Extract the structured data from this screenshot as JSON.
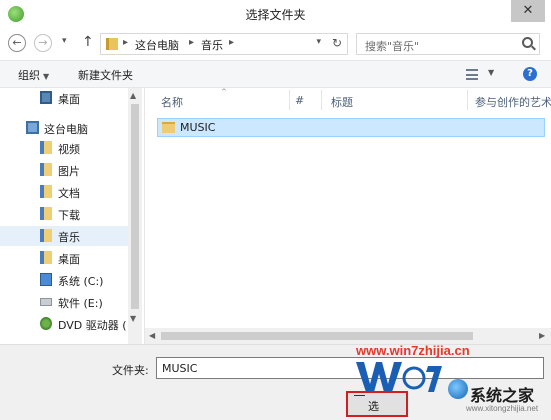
{
  "window": {
    "title": "选择文件夹",
    "close_glyph": "✕"
  },
  "nav": {
    "back_glyph": "←",
    "forward_glyph": "→",
    "history_glyph": "▾",
    "up_glyph": "↑",
    "breadcrumb": [
      "这台电脑",
      "音乐"
    ],
    "crumb_sep": "▸",
    "dropdown_glyph": "▾",
    "refresh_glyph": "↻"
  },
  "search": {
    "placeholder": "搜索\"音乐\""
  },
  "toolbar": {
    "organize_label": "组织",
    "organize_caret": "▼",
    "new_folder_label": "新建文件夹",
    "view_caret": "▼",
    "help_glyph": "?"
  },
  "sidebar": {
    "items": [
      {
        "label": "桌面",
        "icon": "desktop-icon"
      },
      {
        "label": "这台电脑",
        "icon": "computer-icon"
      },
      {
        "label": "视频",
        "icon": "video-folder-icon"
      },
      {
        "label": "图片",
        "icon": "pictures-folder-icon"
      },
      {
        "label": "文档",
        "icon": "documents-folder-icon"
      },
      {
        "label": "下载",
        "icon": "downloads-folder-icon"
      },
      {
        "label": "音乐",
        "icon": "music-folder-icon",
        "selected": true
      },
      {
        "label": "桌面",
        "icon": "desktop-folder-icon"
      },
      {
        "label": "系统 (C:)",
        "icon": "system-drive-icon"
      },
      {
        "label": "软件 (E:)",
        "icon": "drive-icon"
      },
      {
        "label": "DVD 驱动器 (",
        "icon": "dvd-drive-icon"
      }
    ],
    "scroll_up": "▲",
    "scroll_down": "▼"
  },
  "file_list": {
    "columns": [
      "名称",
      "#",
      "标题",
      "参与创作的艺术"
    ],
    "sort_glyph": "^",
    "rows": [
      {
        "name": "MUSIC",
        "icon": "folder-icon"
      }
    ],
    "scroll_left": "◀",
    "scroll_right": "▶"
  },
  "footer": {
    "folder_label": "文件夹:",
    "folder_value": "MUSIC",
    "select_button_label": "选"
  },
  "watermark": {
    "url": "www.win7zhijia.cn",
    "brand": "系统之家",
    "site": "www.xitongzhijia.net",
    "colors": {
      "url": "#e8382a",
      "logo_blue": "#1a5fb4"
    }
  },
  "colors": {
    "selection": "#cce8ff",
    "sidebar_selection": "#e5f0fb",
    "accent": "#2b6fd1",
    "highlight_border": "#d21e1e"
  }
}
